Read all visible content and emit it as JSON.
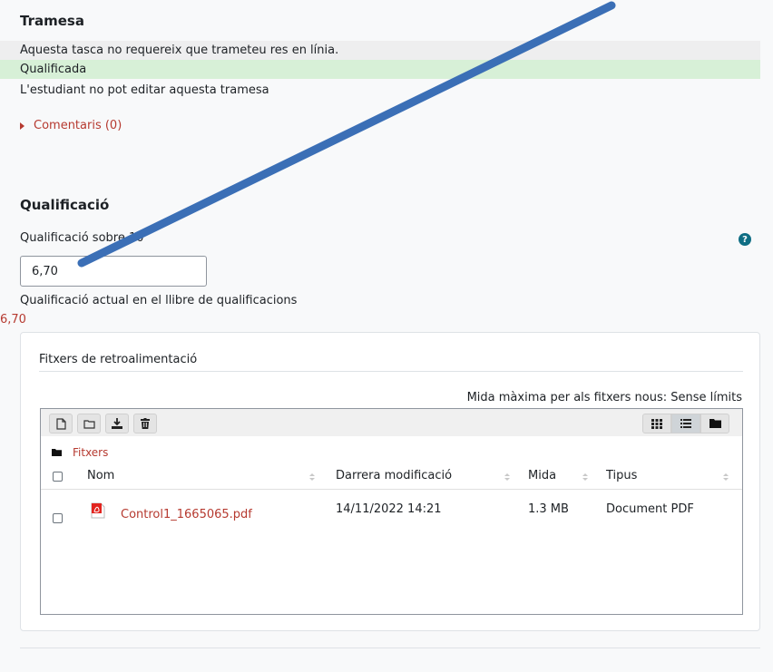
{
  "submission": {
    "title": "Tramesa",
    "no_online_text": "Aquesta tasca no requereix que trameteu res en línia.",
    "status": "Qualificada",
    "edit_status": "L'estudiant no pot editar aquesta tramesa",
    "comments_link": "Comentaris (0)"
  },
  "grading": {
    "title": "Qualificació",
    "grade_out_of_label": "Qualificació sobre 10",
    "grade_value": "6,70",
    "current_grade_label": "Qualificació actual en el llibre de qualificacions",
    "current_grade_value": "6,70"
  },
  "feedback_files": {
    "title": "Fitxers de retroalimentació",
    "max_size_text": "Mida màxima per als fitxers nous: Sense límits",
    "toolbar_icons": [
      "add-file-icon",
      "create-folder-icon",
      "download-icon",
      "delete-icon"
    ],
    "view_icons": [
      "grid-view-icon",
      "list-view-icon",
      "tree-view-icon"
    ],
    "active_view": "list-view-icon",
    "breadcrumb": "Fitxers",
    "columns": [
      "Nom",
      "Darrera modificació",
      "Mida",
      "Tipus"
    ],
    "files": [
      {
        "name": "Control1_1665065.pdf",
        "modified": "14/11/2022 14:21",
        "size": "1.3 MB",
        "type": "Document PDF",
        "icon": "pdf-file-icon"
      }
    ]
  },
  "annotation": {
    "type": "arrow",
    "color": "#3b6fb6",
    "icon": "blue-arrow-annotation"
  },
  "colors": {
    "link": "#b63a30",
    "success_bg": "#d7f0d7",
    "help": "#0f6e84"
  }
}
